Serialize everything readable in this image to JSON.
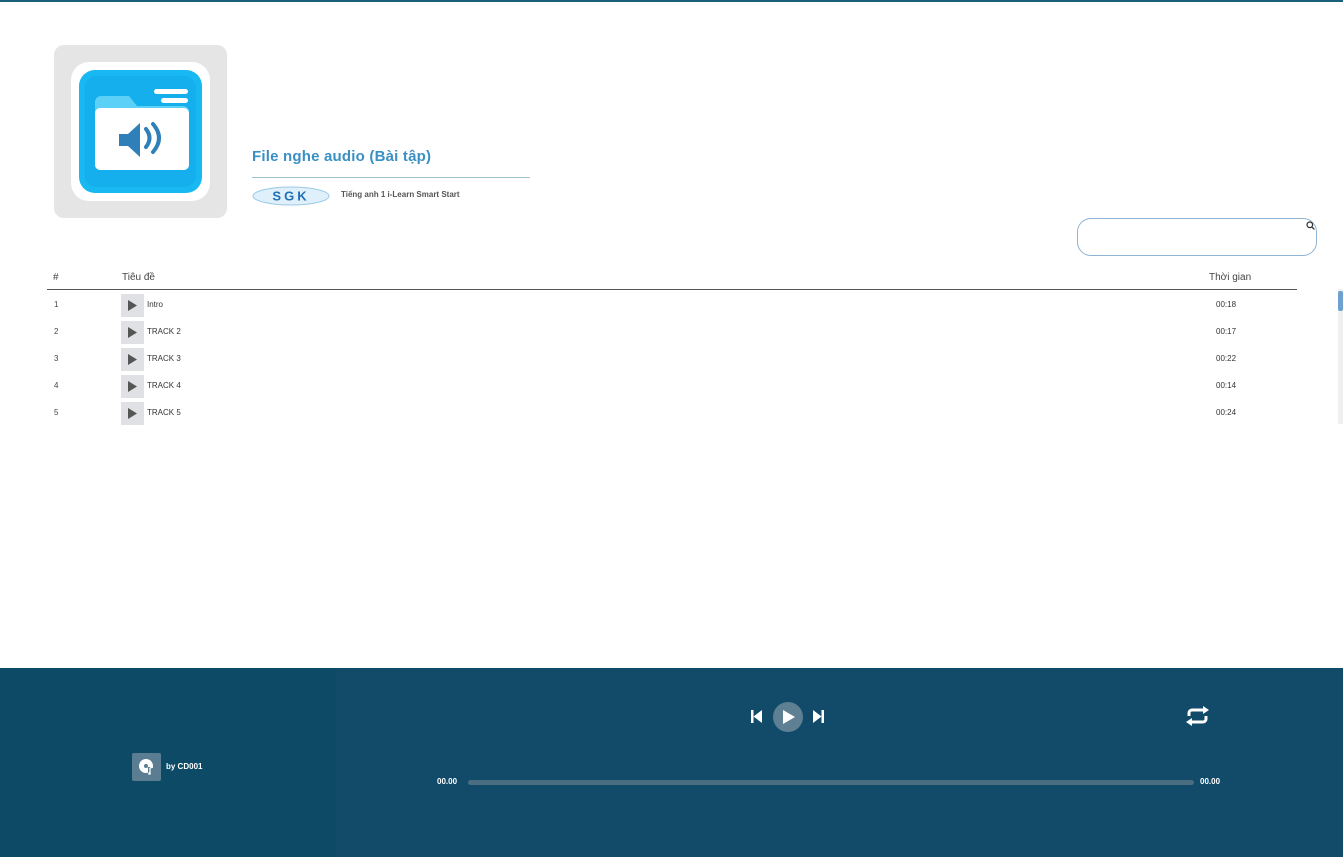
{
  "album": {
    "title": "File nghe audio (Bài tập)",
    "publisher_logo_text": "SGK",
    "book_name": "Tiếng anh 1 i-Learn Smart Start",
    "cover_icon": "audio-folder-icon"
  },
  "search": {
    "placeholder": "",
    "value": "",
    "icon": "search-icon"
  },
  "table": {
    "headers": {
      "num": "#",
      "title": "Tiêu đề",
      "time": "Thời gian"
    },
    "rows": [
      {
        "num": "1",
        "title": "Intro",
        "duration": "00:18"
      },
      {
        "num": "2",
        "title": "TRACK 2",
        "duration": "00:17"
      },
      {
        "num": "3",
        "title": "TRACK 3",
        "duration": "00:22"
      },
      {
        "num": "4",
        "title": "TRACK 4",
        "duration": "00:14"
      },
      {
        "num": "5",
        "title": "TRACK 5",
        "duration": "00:24"
      }
    ]
  },
  "player": {
    "by_label": "by CD001",
    "current_time": "00.00",
    "total_time": "00.00",
    "progress": 0,
    "colors": {
      "left_panel": "#0d4a66",
      "right_panel": "#124b69",
      "accent": "#3a8fc4"
    }
  }
}
